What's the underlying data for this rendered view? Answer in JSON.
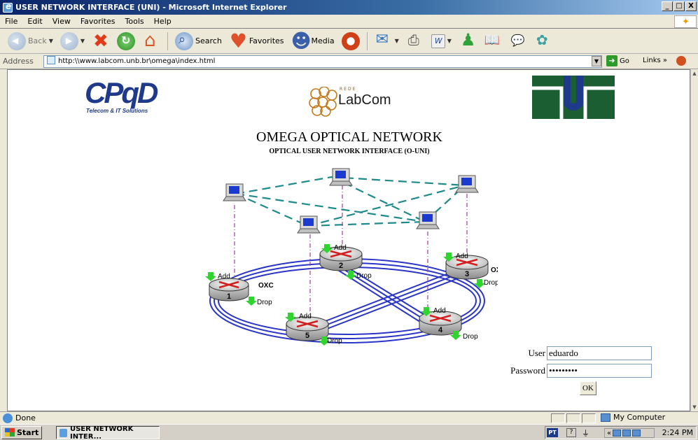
{
  "window": {
    "title": "USER NETWORK INTERFACE (UNI) - Microsoft Internet Explorer",
    "btn_min": "_",
    "btn_max": "□",
    "btn_close": "X"
  },
  "menu": {
    "items": [
      "File",
      "Edit",
      "View",
      "Favorites",
      "Tools",
      "Help"
    ]
  },
  "toolbar": {
    "back": "Back",
    "search": "Search",
    "favorites": "Favorites",
    "media": "Media"
  },
  "address": {
    "label": "Address",
    "url": "http:\\\\www.labcom.unb.br\\omega\\index.html",
    "go": "Go",
    "links": "Links"
  },
  "page": {
    "cpqd_logo": "CPqD",
    "cpqd_tagline": "Telecom & IT Solutions",
    "labcom_rede": "REDE",
    "labcom_name": "LabCom",
    "title": "OMEGA OPTICAL NETWORK",
    "subtitle": "OPTICAL USER NETWORK INTERFACE (O-UNI)"
  },
  "diagram": {
    "nodes": [
      {
        "id": "1",
        "label": "1",
        "add": "Add",
        "drop": "Drop",
        "oxc": "OXC"
      },
      {
        "id": "2",
        "label": "2",
        "add": "Add",
        "drop": "Drop"
      },
      {
        "id": "3",
        "label": "3",
        "add": "Add",
        "drop": "Drop",
        "oxc": "OXC"
      },
      {
        "id": "4",
        "label": "4",
        "add": "Add",
        "drop": "Drop"
      },
      {
        "id": "5",
        "label": "5",
        "add": "Add",
        "drop": "Drop"
      }
    ],
    "colors": {
      "fiber": "#2a35c8",
      "mesh": "#1f8a8a",
      "access": "#a040a0",
      "arrow": "#2fd42f"
    }
  },
  "login": {
    "user_label": "User",
    "user_value": "eduardo",
    "password_label": "Password",
    "password_value": "•••••••••",
    "ok": "OK"
  },
  "status": {
    "text": "Done",
    "zone": "My Computer"
  },
  "taskbar": {
    "start": "Start",
    "task": "USER NETWORK INTER...",
    "lang": "PT",
    "help": "?",
    "clock": "2:24 PM"
  }
}
